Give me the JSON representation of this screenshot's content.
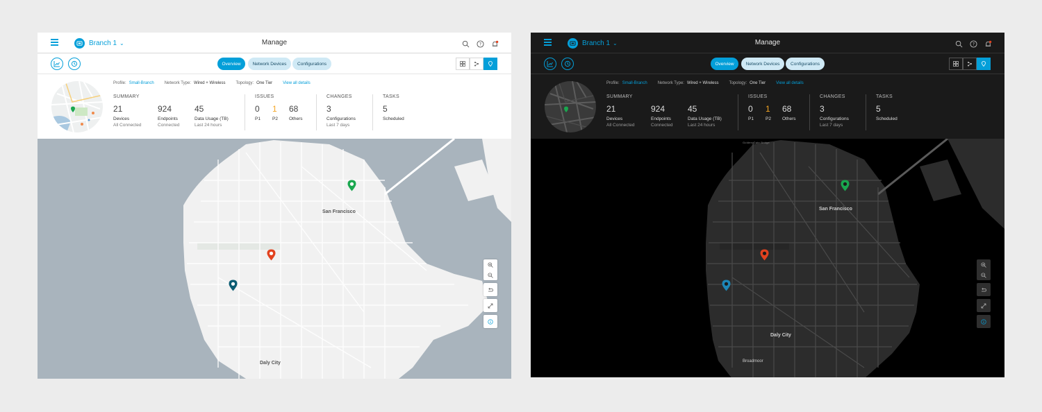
{
  "colors": {
    "accent": "#049fd9",
    "pin_green": "#1aa74f",
    "pin_red": "#e2421f",
    "pin_teal": "#0b5c73",
    "pin_blue_dark": "#1d86b6",
    "p2_orange": "#f5a623",
    "water_light": "#a9b4bd",
    "land_light": "#f1f1f1",
    "water_dark": "#000000",
    "land_dark": "#2c2c2c"
  },
  "header": {
    "brand_icon": "branch-site-icon",
    "site_name": "Branch 1",
    "page_title": "Manage",
    "icons": [
      "search-icon",
      "help-icon",
      "notification-bell-icon"
    ]
  },
  "toolbar": {
    "left_icons": [
      "analytics-chart-icon",
      "history-clock-icon"
    ],
    "tabs": [
      {
        "label": "Overview",
        "active": true
      },
      {
        "label": "Network Devices",
        "active": false
      },
      {
        "label": "Configurations",
        "active": false
      }
    ],
    "view_toggle": [
      "grid-view-icon",
      "topology-view-icon",
      "map-view-icon"
    ],
    "active_view": "map-view-icon"
  },
  "profile": {
    "profile_label": "Profile:",
    "profile_value": "Small-Branch",
    "network_label": "Network Type:",
    "network_value": "Wired + Wireless",
    "topology_label": "Topology:",
    "topology_value": "One Tier",
    "details_link": "View all details"
  },
  "summary": {
    "title": "SUMMARY",
    "items": [
      {
        "value": "21",
        "label": "Devices",
        "sub": "All Connected"
      },
      {
        "value": "924",
        "label": "Endpoints",
        "sub": "Connected"
      },
      {
        "value": "45",
        "label": "Data Usage (TB)",
        "sub": "Last 24 hours"
      }
    ]
  },
  "issues": {
    "title": "ISSUES",
    "items": [
      {
        "value": "0",
        "label": "P1"
      },
      {
        "value": "1",
        "label": "P2"
      },
      {
        "value": "68",
        "label": "Others"
      }
    ]
  },
  "changes": {
    "title": "CHANGES",
    "value": "3",
    "label": "Configurations",
    "sub": "Last 7 days"
  },
  "tasks": {
    "title": "TASKS",
    "value": "5",
    "label": "Scheduled"
  },
  "map": {
    "city_label": "San Francisco",
    "district_labels": [
      "Daly City",
      "Broadmoor",
      "Golden Gate Bridge"
    ],
    "controls": [
      "zoom-in-icon",
      "zoom-out-icon",
      "undo-icon",
      "expand-icon",
      "info-icon"
    ]
  }
}
